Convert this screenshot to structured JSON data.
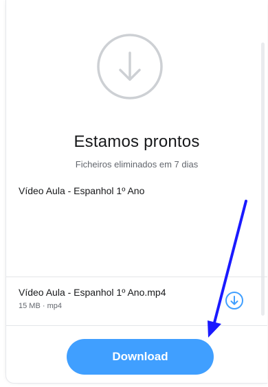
{
  "transfer": {
    "status_title": "Estamos prontos",
    "expiry_note": "Ficheiros eliminados em 7 dias",
    "title": "Vídeo Aula - Espanhol 1º Ano"
  },
  "files": [
    {
      "name": "Vídeo Aula - Espanhol 1º Ano.mp4",
      "size": "15 MB",
      "type": "mp4",
      "meta": "15 MB · mp4"
    }
  ],
  "actions": {
    "download_label": "Download"
  },
  "icons": {
    "hero": "download-circle-icon",
    "file_download": "download-circle-icon",
    "annotation": "arrow-annotation-icon"
  },
  "colors": {
    "accent": "#409fff",
    "hero_icon": "#cdd0d4",
    "annotation_arrow": "#1a1aff"
  }
}
